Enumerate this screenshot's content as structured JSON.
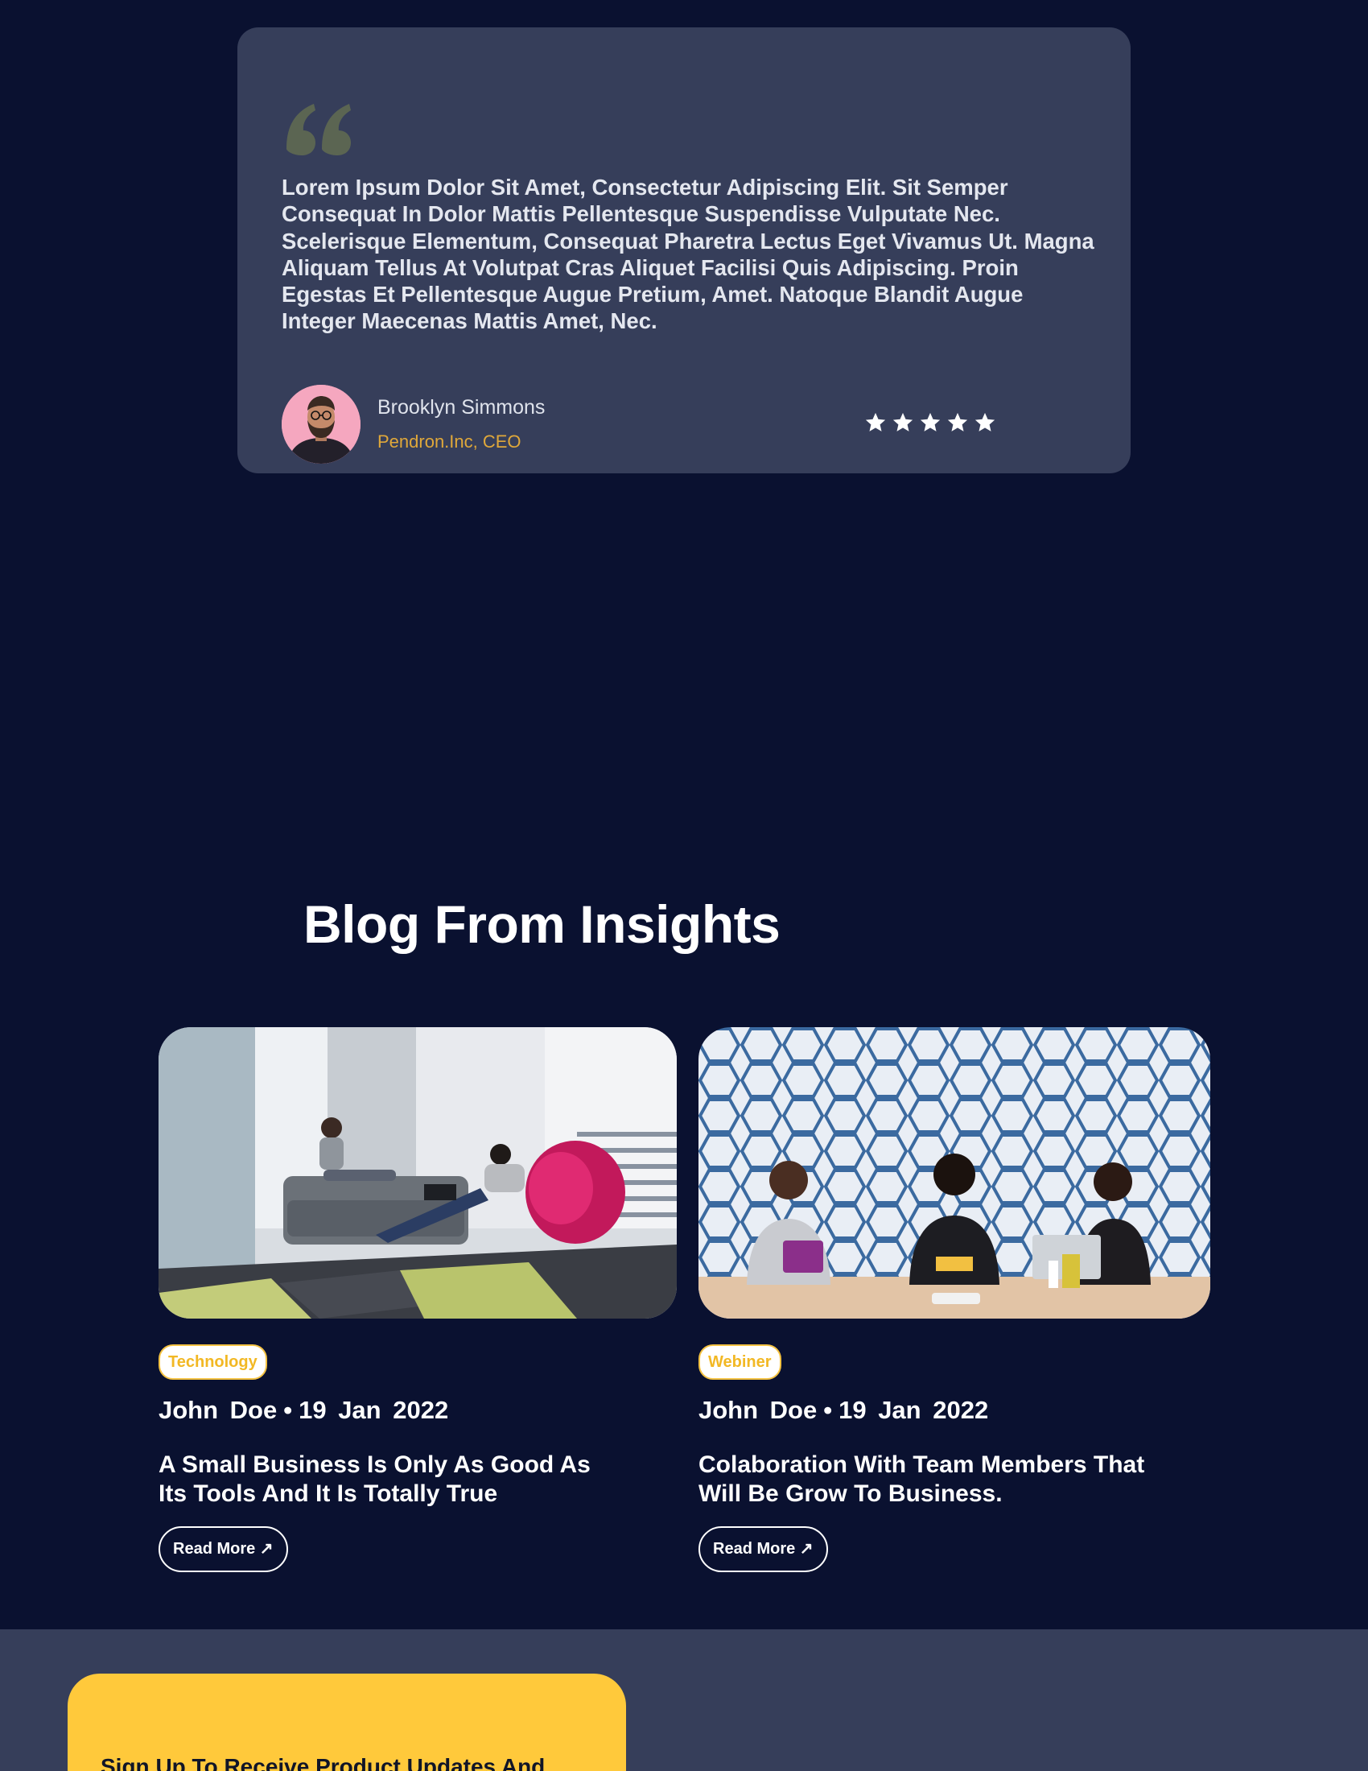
{
  "testimonial": {
    "quote": "Lorem Ipsum Dolor Sit Amet, Consectetur Adipiscing Elit. Sit Semper Consequat In Dolor Mattis Pellentesque Suspendisse Vulputate Nec. Scelerisque Elementum, Consequat Pharetra Lectus Eget Vivamus Ut. Magna Aliquam Tellus At Volutpat Cras Aliquet Facilisi Quis Adipiscing. Proin Egestas Et Pellentesque Augue Pretium, Amet. Natoque Blandit Augue Integer Maecenas Mattis Amet, Nec.",
    "author_name": "Brooklyn Simmons",
    "author_role": "Pendron.Inc, CEO",
    "rating": 5,
    "rating_max": 5,
    "quote_icon": "quote-icon",
    "star_icon": "star-icon",
    "accent_color": "#e0a83a"
  },
  "blog": {
    "title": "Blog From Insights",
    "posts": [
      {
        "tag": "Technology",
        "author": "John Doe",
        "separator": "•",
        "date": "19 Jan 2022",
        "title": "A Small Business Is Only As Good As Its Tools And It Is Totally True",
        "read_more": "Read More ↗"
      },
      {
        "tag": "Webiner",
        "author": "John Doe",
        "separator": "•",
        "date": "19 Jan 2022",
        "title": "Colaboration With Team Members That Will Be Grow To Business.",
        "read_more": "Read More ↗"
      }
    ]
  },
  "signup": {
    "text": "Sign Up To Receive Product Updates And",
    "background_color": "#ffc93b"
  },
  "colors": {
    "page_background": "#0a1130",
    "card_background": "#363e5a",
    "tag_color": "#f2b824"
  }
}
